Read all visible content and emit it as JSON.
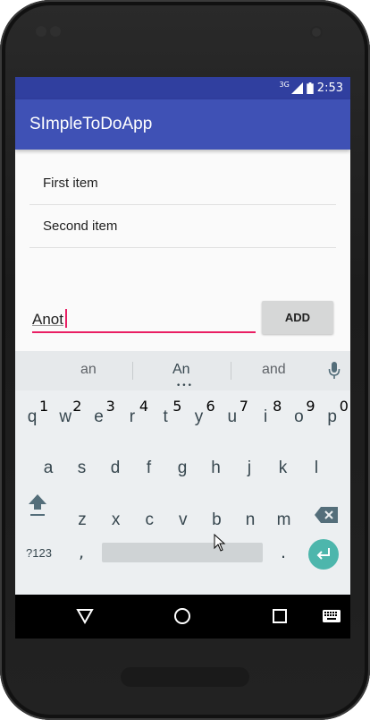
{
  "statusbar": {
    "network_label": "3G",
    "time": "2:53"
  },
  "app": {
    "title": "SImpleToDoApp"
  },
  "items": [
    {
      "label": "First item"
    },
    {
      "label": "Second item"
    }
  ],
  "input": {
    "value": "Anot",
    "placeholder": ""
  },
  "add_button": {
    "label": "ADD"
  },
  "keyboard": {
    "suggestions": [
      "an",
      "An",
      "and"
    ],
    "row1": [
      {
        "k": "q",
        "h": "1"
      },
      {
        "k": "w",
        "h": "2"
      },
      {
        "k": "e",
        "h": "3"
      },
      {
        "k": "r",
        "h": "4"
      },
      {
        "k": "t",
        "h": "5"
      },
      {
        "k": "y",
        "h": "6"
      },
      {
        "k": "u",
        "h": "7"
      },
      {
        "k": "i",
        "h": "8"
      },
      {
        "k": "o",
        "h": "9"
      },
      {
        "k": "p",
        "h": "0"
      }
    ],
    "row2": [
      "a",
      "s",
      "d",
      "f",
      "g",
      "h",
      "j",
      "k",
      "l"
    ],
    "row3": [
      "z",
      "x",
      "c",
      "v",
      "b",
      "n",
      "m"
    ],
    "symbols_label": "?123",
    "comma": ",",
    "period": "."
  },
  "colors": {
    "primary": "#3f51b5",
    "primary_dark": "#303f9f",
    "accent": "#e91e63",
    "enter_key": "#4db6ac"
  },
  "icons": [
    "mic-icon",
    "shift-icon",
    "backspace-icon",
    "enter-icon",
    "back-icon",
    "home-icon",
    "recents-icon",
    "keyboard-switch-icon",
    "battery-icon",
    "signal-icon",
    "mouse-cursor-icon"
  ]
}
